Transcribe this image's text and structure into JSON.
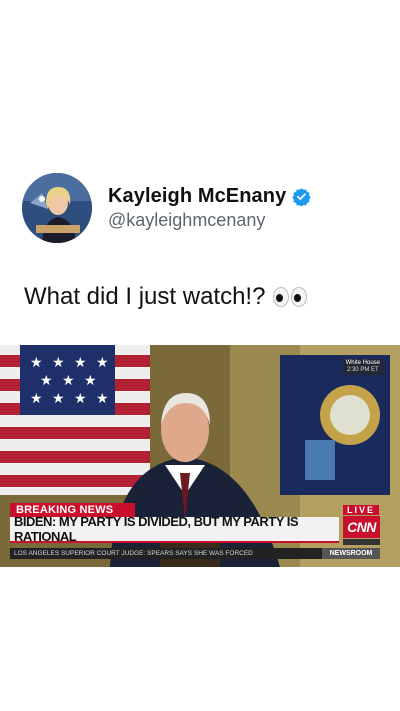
{
  "tweet": {
    "display_name": "Kayleigh McEnany",
    "verified": true,
    "handle": "@kayleighmcenany",
    "text": "What did I just watch!?",
    "emoji": "eyes"
  },
  "video": {
    "bug_line1": "White House",
    "bug_line2": "2:30 PM ET",
    "breaking_label": "BREAKING NEWS",
    "live_label": "LIVE",
    "headline": "BIDEN: MY PARTY IS DIVIDED, BUT MY PARTY IS RATIONAL",
    "network_logo": "CNN",
    "ticker_text": "LOS ANGELES SUPERIOR COURT JUDGE: SPEARS SAYS SHE WAS FORCED",
    "ticker_show": "NEWSROOM"
  },
  "colors": {
    "cnn_red": "#c8102e",
    "verified_blue": "#1d9bf0"
  }
}
